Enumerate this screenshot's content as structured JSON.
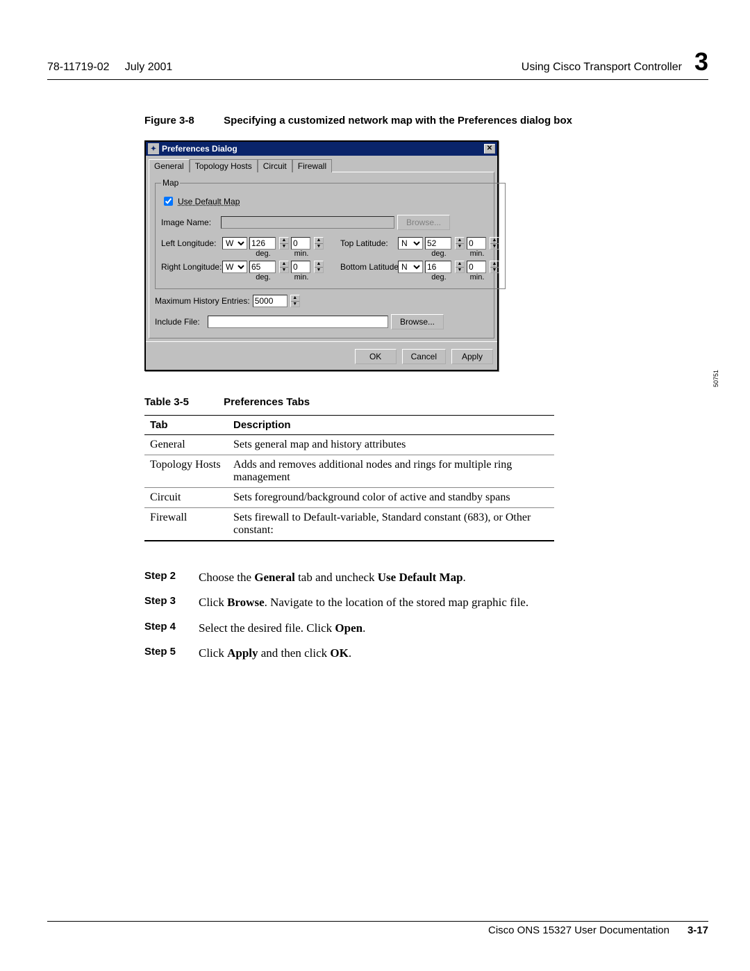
{
  "header": {
    "docnum": "78-11719-02",
    "date": "July 2001",
    "section": "Using Cisco Transport Controller",
    "chapter": "3"
  },
  "figure": {
    "label": "Figure 3-8",
    "title": "Specifying a customized network map with the Preferences dialog box",
    "imageref": "50751"
  },
  "dialog": {
    "title": "Preferences Dialog",
    "tabs": [
      "General",
      "Topology Hosts",
      "Circuit",
      "Firewall"
    ],
    "map_legend": "Map",
    "use_default_label": "Use Default Map",
    "use_default_checked": true,
    "image_name_label": "Image Name:",
    "image_name_value": "",
    "browse_label": "Browse...",
    "left_long_label": "Left Longitude:",
    "right_long_label": "Right Longitude:",
    "top_lat_label": "Top Latitude:",
    "bottom_lat_label": "Bottom Latitude:",
    "dir_w": "W",
    "dir_n": "N",
    "left_deg": "126",
    "left_min": "0",
    "right_deg": "65",
    "right_min": "0",
    "top_deg": "52",
    "top_min": "0",
    "bottom_deg": "16",
    "bottom_min": "0",
    "unit_deg": "deg.",
    "unit_min": "min.",
    "max_hist_label": "Maximum History Entries:",
    "max_hist_value": "5000",
    "include_file_label": "Include File:",
    "include_file_value": "",
    "ok": "OK",
    "cancel": "Cancel",
    "apply": "Apply"
  },
  "table": {
    "label": "Table 3-5",
    "title": "Preferences Tabs",
    "col1": "Tab",
    "col2": "Description",
    "rows": [
      {
        "tab": "General",
        "desc": "Sets general map and history attributes"
      },
      {
        "tab": "Topology Hosts",
        "desc": "Adds and removes additional nodes and rings for multiple ring management"
      },
      {
        "tab": "Circuit",
        "desc": "Sets foreground/background color of active and standby spans"
      },
      {
        "tab": "Firewall",
        "desc": "Sets firewall to Default-variable, Standard constant (683), or Other constant:"
      }
    ]
  },
  "steps": [
    {
      "n": "Step 2",
      "pre": "Choose the ",
      "b1": "General",
      "mid": " tab and uncheck ",
      "b2": "Use Default Map",
      "post": "."
    },
    {
      "n": "Step 3",
      "pre": "Click ",
      "b1": "Browse",
      "mid": ". Navigate to the location of the stored map graphic file.",
      "b2": "",
      "post": ""
    },
    {
      "n": "Step 4",
      "pre": "Select the desired file. Click ",
      "b1": "Open",
      "mid": ".",
      "b2": "",
      "post": ""
    },
    {
      "n": "Step 5",
      "pre": "Click ",
      "b1": "Apply",
      "mid": " and then click ",
      "b2": "OK",
      "post": "."
    }
  ],
  "footer": {
    "doc": "Cisco ONS 15327 User Documentation",
    "page": "3-17"
  }
}
